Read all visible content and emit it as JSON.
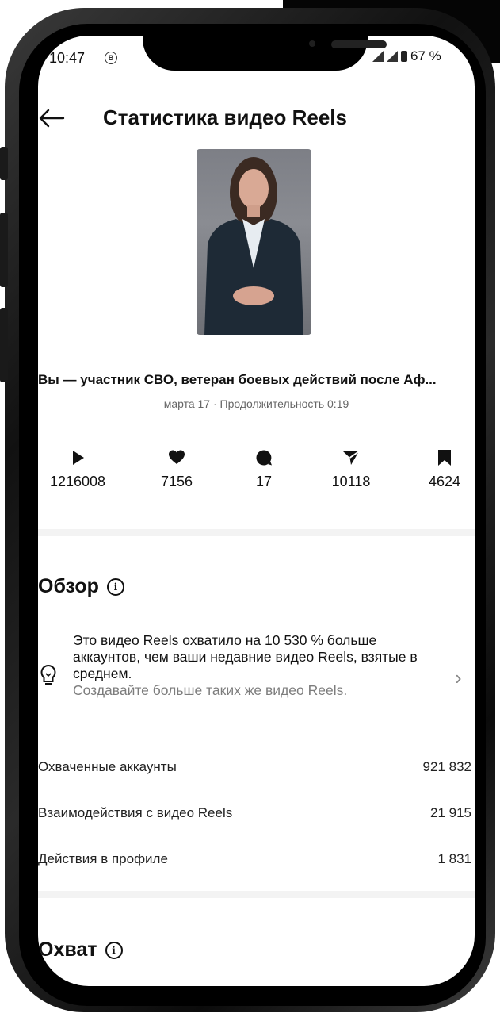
{
  "status_bar": {
    "time": "10:47",
    "indicator": "B",
    "battery": "67 %"
  },
  "header": {
    "title": "Статистика видео Reels",
    "back_icon": "arrow-left-icon"
  },
  "video": {
    "caption": "Вы — участник СВО, ветеран боевых действий после Аф...",
    "meta": "марта 17 · Продолжительность 0:19"
  },
  "metrics": [
    {
      "icon": "play-icon",
      "value": "1216008"
    },
    {
      "icon": "heart-icon",
      "value": "7156"
    },
    {
      "icon": "comment-icon",
      "value": "17"
    },
    {
      "icon": "share-icon",
      "value": "10118"
    },
    {
      "icon": "bookmark-icon",
      "value": "4624"
    }
  ],
  "overview": {
    "title": "Обзор",
    "insight_text": "Это видео Reels охватило на 10 530 % больше аккаунтов, чем ваши недавние видео Reels, взятые в среднем.",
    "insight_sub": "Создавайте больше таких же видео Reels.",
    "stats": [
      {
        "label": "Охваченные аккаунты",
        "value": "921 832"
      },
      {
        "label": "Взаимодействия с видео Reels",
        "value": "21 915"
      },
      {
        "label": "Действия в профиле",
        "value": "1 831"
      }
    ]
  },
  "reach": {
    "title": "Охват"
  }
}
